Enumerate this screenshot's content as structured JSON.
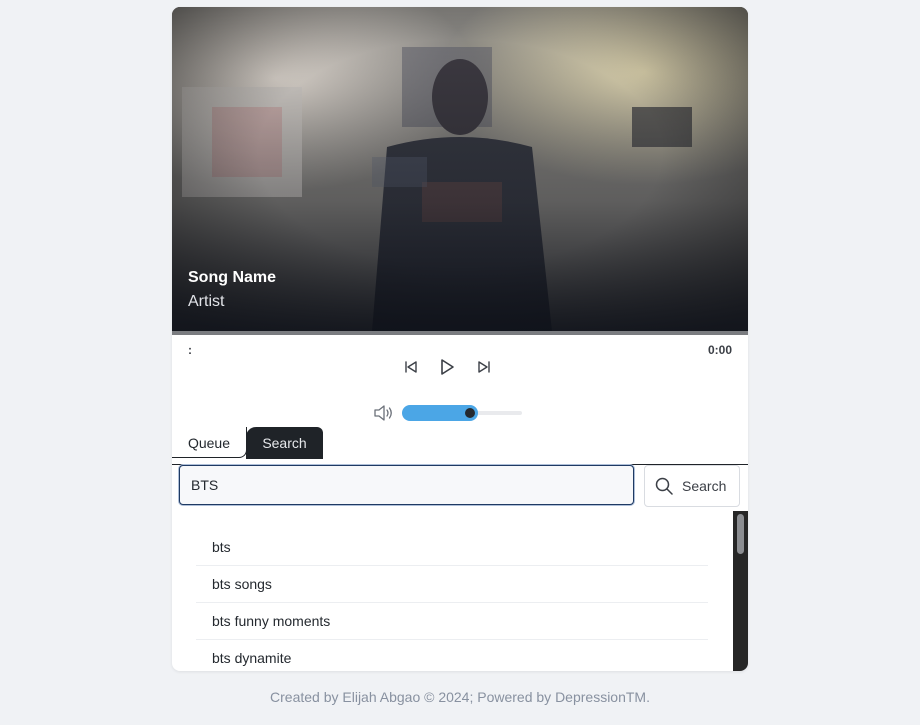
{
  "player": {
    "song_name": "Song Name",
    "artist": "Artist",
    "time_elapsed": ":",
    "time_total": "0:00",
    "progress": 0,
    "volume_level": 0.6,
    "controls": {
      "previous_icon": "skip-back-icon",
      "play_icon": "play-icon",
      "next_icon": "skip-forward-icon",
      "volume_icon": "volume-icon"
    }
  },
  "tabs": [
    {
      "label": "Queue",
      "active": false
    },
    {
      "label": "Search",
      "active": true
    }
  ],
  "search": {
    "value": "BTS",
    "button_label": "Search",
    "button_icon": "search-icon"
  },
  "suggestions": [
    "bts",
    "bts songs",
    "bts funny moments",
    "bts dynamite"
  ],
  "footer": {
    "text": "Created by Elijah Abgao © 2024; Powered by DepressionTM."
  },
  "colors": {
    "accent": "#4ba6e6",
    "dark": "#1f2328",
    "page_background": "#f0f2f5"
  }
}
